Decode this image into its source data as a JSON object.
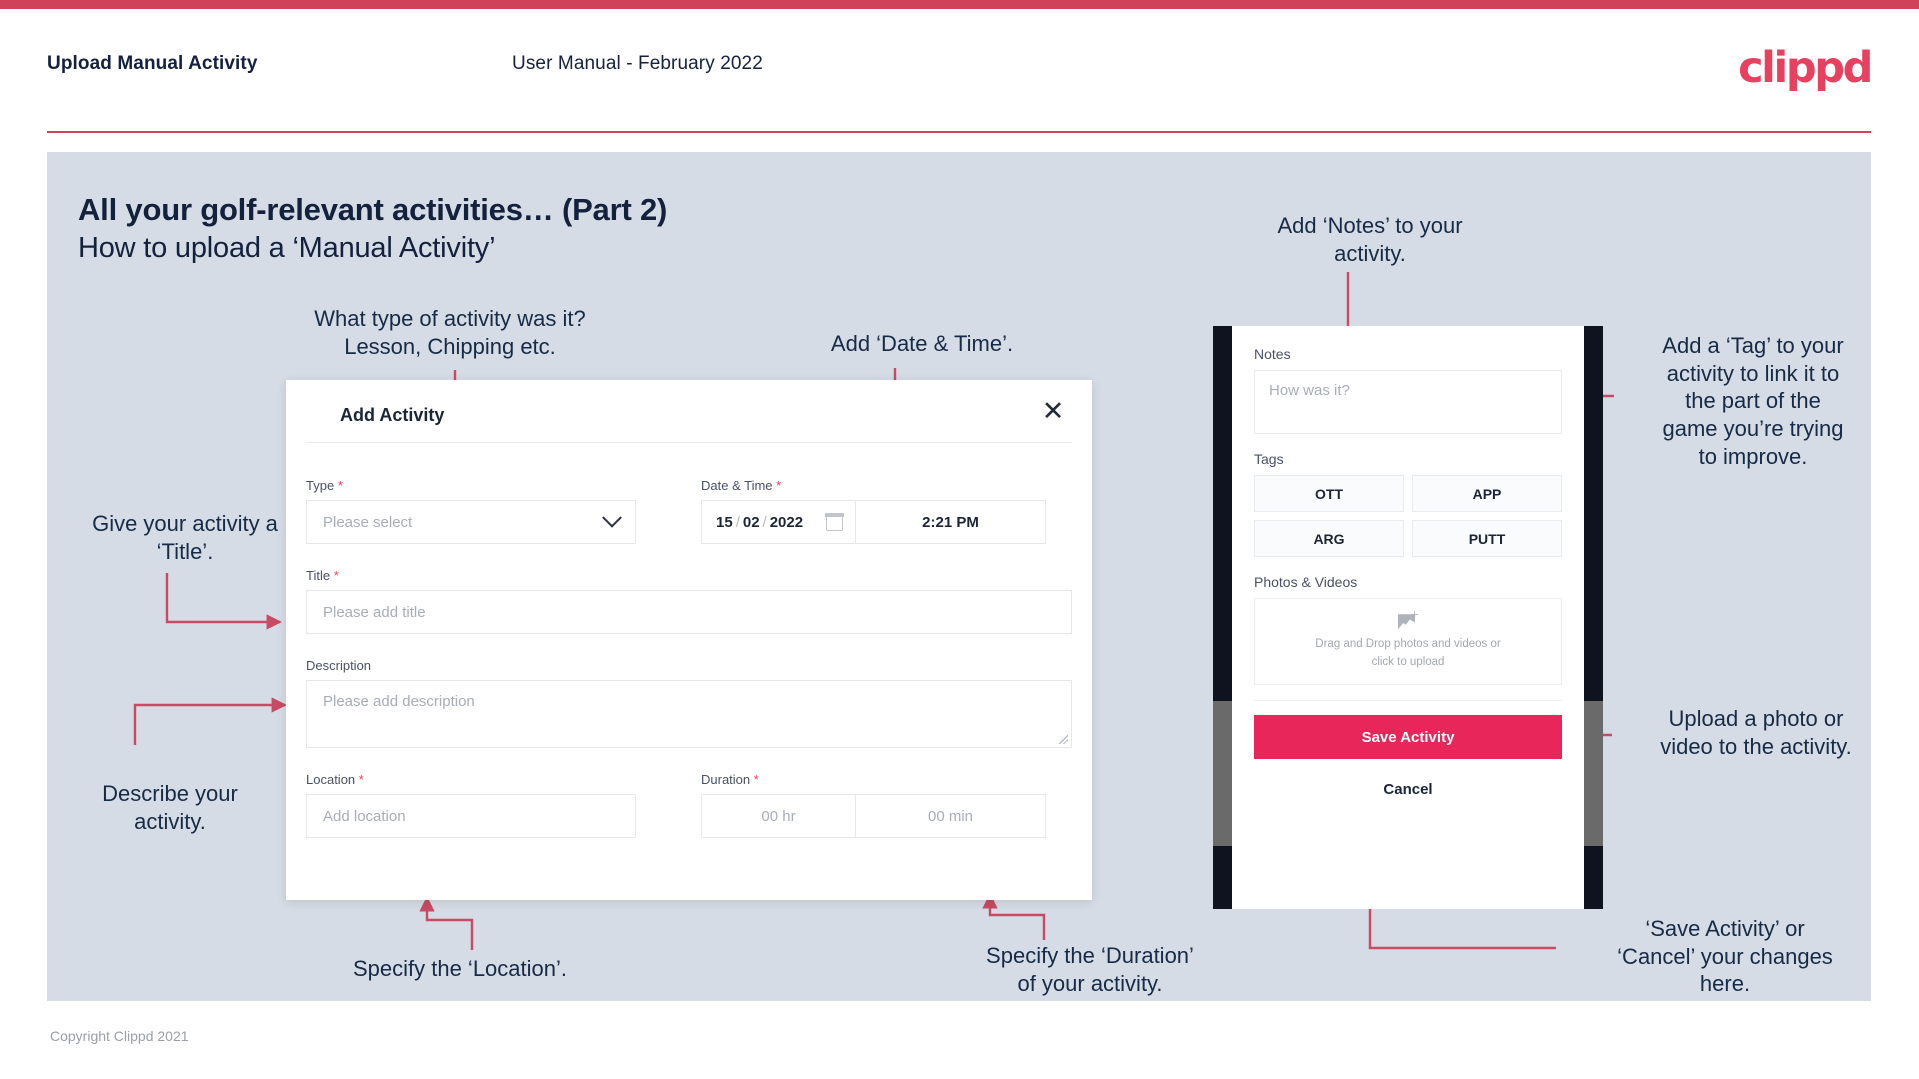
{
  "header": {
    "title": "Upload Manual Activity",
    "subtitle": "User Manual - February 2022",
    "logo": "clippd"
  },
  "slide": {
    "title": "All your golf-relevant activities… (Part 2)",
    "subtitle": "How to upload a ‘Manual Activity’"
  },
  "footer": {
    "copyright": "Copyright Clippd 2021"
  },
  "annotations": {
    "type": "What type of activity was it?\nLesson, Chipping etc.",
    "datetime": "Add ‘Date & Time’.",
    "title": "Give your activity a\n‘Title’.",
    "description": "Describe your\nactivity.",
    "location": "Specify the ‘Location’.",
    "duration": "Specify the ‘Duration’\nof your activity.",
    "notes": "Add ‘Notes’ to your\nactivity.",
    "tags": "Add a ‘Tag’ to your\nactivity to link it to\nthe part of the\ngame you’re trying\nto improve.",
    "photos": "Upload a photo or\nvideo to the activity.",
    "save": "‘Save Activity’ or\n‘Cancel’ your changes\nhere."
  },
  "modal": {
    "title": "Add Activity",
    "close_icon": "close-icon",
    "fields": {
      "type": {
        "label": "Type",
        "required": "*",
        "placeholder": "Please select",
        "icon": "chevron-down-icon"
      },
      "datetime": {
        "label": "Date & Time",
        "required": "*",
        "day": "15",
        "month": "02",
        "year": "2022",
        "sep": "/",
        "calendar_icon": "calendar-icon",
        "time": "2:21 PM"
      },
      "title": {
        "label": "Title",
        "required": "*",
        "placeholder": "Please add title"
      },
      "description": {
        "label": "Description",
        "required": "",
        "placeholder": "Please add description"
      },
      "location": {
        "label": "Location",
        "required": "*",
        "placeholder": "Add location"
      },
      "duration": {
        "label": "Duration",
        "required": "*",
        "hours_placeholder": "00 hr",
        "minutes_placeholder": "00 min"
      }
    }
  },
  "phone": {
    "notes": {
      "label": "Notes",
      "placeholder": "How was it?"
    },
    "tags": {
      "label": "Tags",
      "options": [
        "OTT",
        "APP",
        "ARG",
        "PUTT"
      ]
    },
    "photos": {
      "label": "Photos & Videos",
      "dropzone_line1": "Drag and Drop photos and videos or",
      "dropzone_line2": "click to upload",
      "icon": "add-image-icon"
    },
    "save_label": "Save Activity",
    "cancel_label": "Cancel"
  },
  "colors": {
    "accent": "#e8415f",
    "save_button": "#e8265a",
    "slide_bg": "#d5dce5",
    "text_dark": "#14213d",
    "connector": "#c94a63"
  }
}
